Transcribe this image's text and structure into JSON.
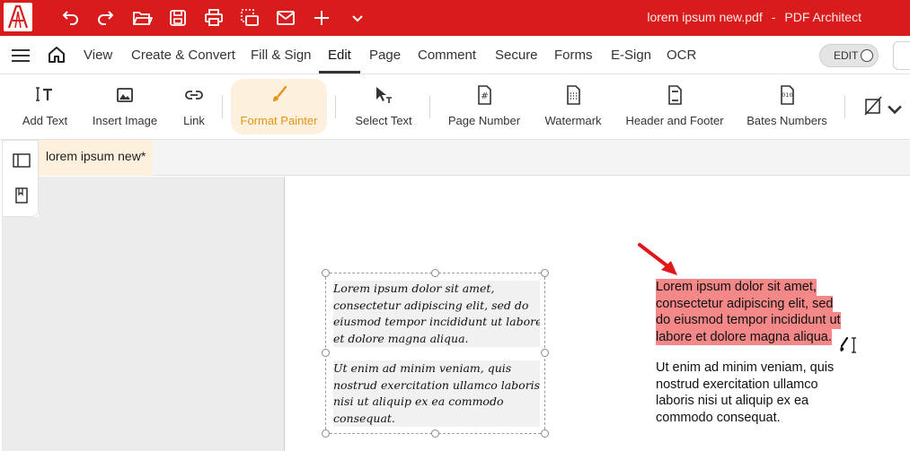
{
  "titlebar": {
    "document_title": "lorem ipsum new.pdf",
    "separator": "-",
    "app_name": "PDF Architect",
    "quick_access": [
      "undo-icon",
      "redo-icon",
      "open-folder-icon",
      "save-icon",
      "print-icon",
      "scan-icon",
      "mail-icon",
      "add-icon",
      "chevron-down-icon"
    ]
  },
  "menubar": {
    "items": [
      "View",
      "Create & Convert",
      "Fill & Sign",
      "Edit",
      "Page",
      "Comment",
      "Secure",
      "Forms",
      "E-Sign",
      "OCR"
    ],
    "active": "Edit",
    "edit_toggle_label": "EDIT"
  },
  "toolbar": {
    "tools": [
      {
        "label": "Add Text",
        "icon": "add-text-icon"
      },
      {
        "label": "Insert Image",
        "icon": "image-icon"
      },
      {
        "label": "Link",
        "icon": "link-icon"
      },
      {
        "label": "Format Painter",
        "icon": "brush-icon",
        "active": true
      },
      {
        "label": "Select Text",
        "icon": "select-text-icon"
      },
      {
        "label": "Page Number",
        "icon": "page-number-icon"
      },
      {
        "label": "Watermark",
        "icon": "watermark-icon"
      },
      {
        "label": "Header and Footer",
        "icon": "header-footer-icon"
      },
      {
        "label": "Bates Numbers",
        "icon": "bates-icon"
      }
    ]
  },
  "document_tab": {
    "label": "lorem ipsum new*"
  },
  "page": {
    "script_paragraph_1": [
      "Lorem ipsum dolor sit amet,",
      "consectetur adipiscing elit, sed do",
      "eiusmod tempor incididunt ut labore",
      "et dolore magna aliqua."
    ],
    "script_paragraph_2": [
      "Ut enim ad minim veniam, quis",
      "nostrud exercitation ullamco laboris",
      "nisi ut aliquip ex ea commodo",
      "consequat."
    ],
    "selected_paragraph": [
      "Lorem ipsum dolor sit amet,",
      "consectetur adipiscing elit, sed",
      "do eiusmod tempor incididunt ut",
      "labore et dolore magna aliqua."
    ],
    "plain_paragraph": [
      "Ut enim ad minim veniam, quis",
      "nostrud exercitation ullamco",
      "laboris nisi ut aliquip ex ea",
      "commodo consequat."
    ]
  },
  "colors": {
    "titlebar": "#d81b1b",
    "active_tool_bg": "#fdf0dc",
    "active_tool_text": "#e69416",
    "selection": "#f48888",
    "arrow": "#e0161b"
  }
}
